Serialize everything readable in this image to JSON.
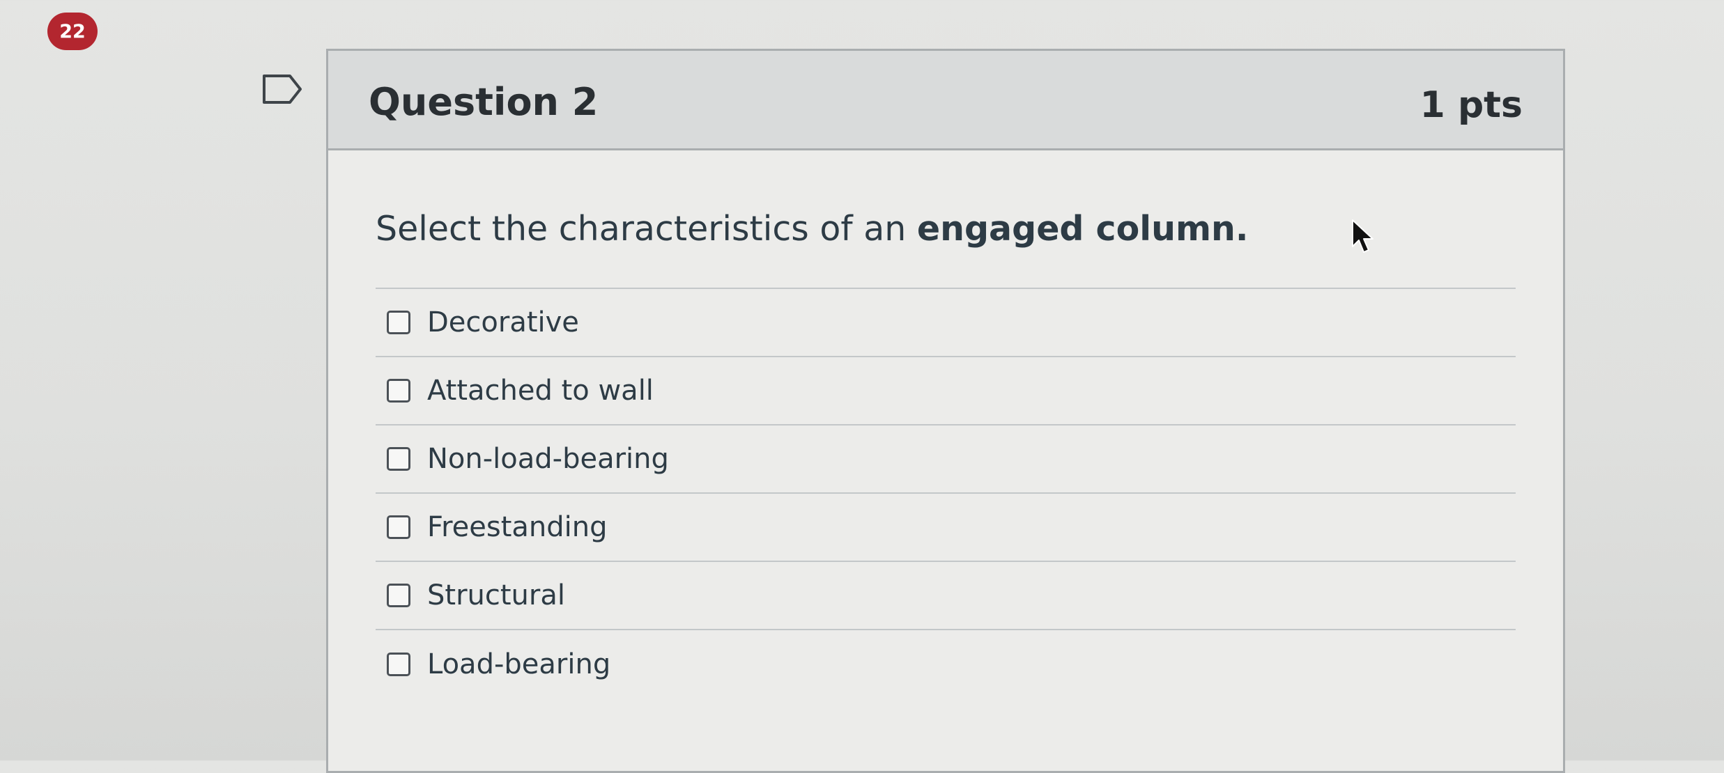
{
  "counter_badge": "22",
  "question": {
    "title": "Question 2",
    "points": "1 pts",
    "text_prefix": "Select the characteristics of an ",
    "text_bold": "engaged column.",
    "answers": [
      {
        "label": "Decorative",
        "checked": false
      },
      {
        "label": "Attached to wall",
        "checked": false
      },
      {
        "label": "Non-load-bearing",
        "checked": false
      },
      {
        "label": "Freestanding",
        "checked": false
      },
      {
        "label": "Structural",
        "checked": false
      },
      {
        "label": "Load-bearing",
        "checked": false
      }
    ]
  },
  "icons": {
    "flag": "bookmark-flag-icon",
    "cursor": "mouse-pointer-icon"
  },
  "colors": {
    "badge": "#b3262f",
    "header_bg": "#d9dbdb",
    "border": "#a9adaf",
    "text": "#2d3b45"
  }
}
